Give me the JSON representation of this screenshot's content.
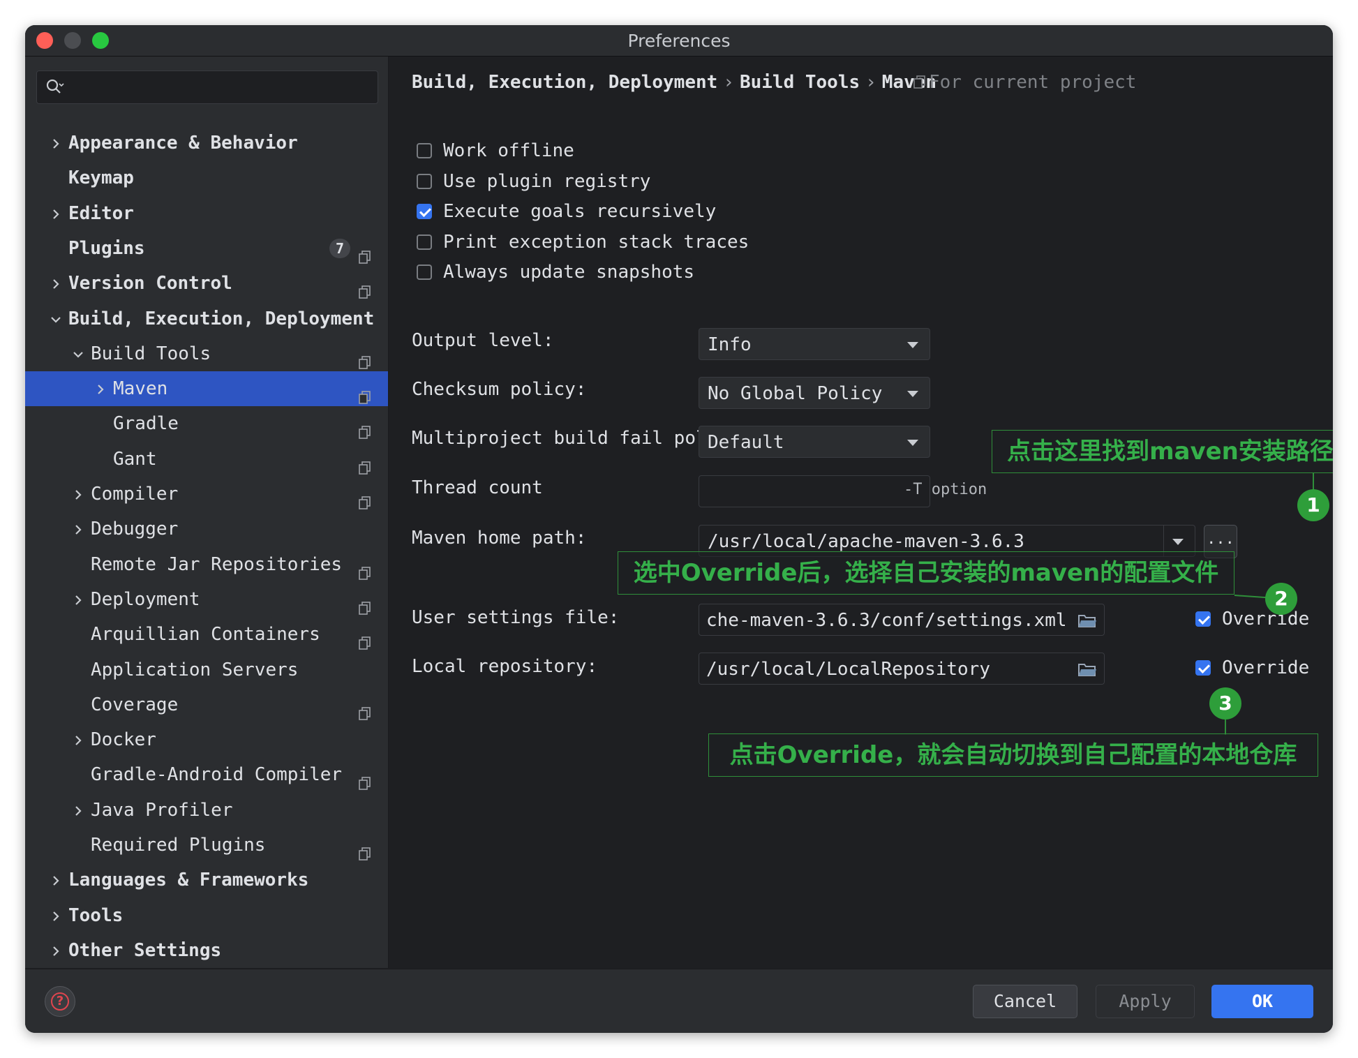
{
  "window": {
    "title": "Preferences"
  },
  "sidebar": {
    "search": {
      "placeholder": ""
    },
    "items": [
      {
        "label": "Appearance & Behavior",
        "expandable": true,
        "expanded": false,
        "bold": true,
        "level": 0,
        "project": false
      },
      {
        "label": "Keymap",
        "expandable": false,
        "bold": true,
        "level": 0,
        "project": false
      },
      {
        "label": "Editor",
        "expandable": true,
        "expanded": false,
        "bold": true,
        "level": 0,
        "project": false
      },
      {
        "label": "Plugins",
        "expandable": false,
        "bold": true,
        "level": 0,
        "project": true,
        "badge": "7"
      },
      {
        "label": "Version Control",
        "expandable": true,
        "expanded": false,
        "bold": true,
        "level": 0,
        "project": true
      },
      {
        "label": "Build, Execution, Deployment",
        "expandable": true,
        "expanded": true,
        "bold": true,
        "level": 0,
        "project": false
      },
      {
        "label": "Build Tools",
        "expandable": true,
        "expanded": true,
        "bold": false,
        "level": 1,
        "project": true
      },
      {
        "label": "Maven",
        "expandable": true,
        "expanded": false,
        "bold": false,
        "level": 2,
        "project": true,
        "selected": true
      },
      {
        "label": "Gradle",
        "expandable": false,
        "bold": false,
        "level": 2,
        "project": true
      },
      {
        "label": "Gant",
        "expandable": false,
        "bold": false,
        "level": 2,
        "project": true
      },
      {
        "label": "Compiler",
        "expandable": true,
        "expanded": false,
        "bold": false,
        "level": 1,
        "project": true
      },
      {
        "label": "Debugger",
        "expandable": true,
        "expanded": false,
        "bold": false,
        "level": 1,
        "project": false
      },
      {
        "label": "Remote Jar Repositories",
        "expandable": false,
        "bold": false,
        "level": 1,
        "project": true
      },
      {
        "label": "Deployment",
        "expandable": true,
        "expanded": false,
        "bold": false,
        "level": 1,
        "project": true
      },
      {
        "label": "Arquillian Containers",
        "expandable": false,
        "bold": false,
        "level": 1,
        "project": true
      },
      {
        "label": "Application Servers",
        "expandable": false,
        "bold": false,
        "level": 1,
        "project": false
      },
      {
        "label": "Coverage",
        "expandable": false,
        "bold": false,
        "level": 1,
        "project": true
      },
      {
        "label": "Docker",
        "expandable": true,
        "expanded": false,
        "bold": false,
        "level": 1,
        "project": false
      },
      {
        "label": "Gradle-Android Compiler",
        "expandable": false,
        "bold": false,
        "level": 1,
        "project": true
      },
      {
        "label": "Java Profiler",
        "expandable": true,
        "expanded": false,
        "bold": false,
        "level": 1,
        "project": false
      },
      {
        "label": "Required Plugins",
        "expandable": false,
        "bold": false,
        "level": 1,
        "project": true
      },
      {
        "label": "Languages & Frameworks",
        "expandable": true,
        "expanded": false,
        "bold": true,
        "level": 0,
        "project": false
      },
      {
        "label": "Tools",
        "expandable": true,
        "expanded": false,
        "bold": true,
        "level": 0,
        "project": false
      },
      {
        "label": "Other Settings",
        "expandable": true,
        "expanded": false,
        "bold": true,
        "level": 0,
        "project": false
      }
    ]
  },
  "breadcrumb": {
    "parts": [
      "Build, Execution, Deployment",
      "Build Tools",
      "Maven"
    ],
    "separator": "›",
    "scope": "For current project"
  },
  "settings": {
    "checkboxes": [
      {
        "label": "Work offline",
        "checked": false
      },
      {
        "label": "Use plugin registry",
        "checked": false
      },
      {
        "label": "Execute goals recursively",
        "checked": true
      },
      {
        "label": "Print exception stack traces",
        "checked": false
      },
      {
        "label": "Always update snapshots",
        "checked": false
      }
    ],
    "output_level": {
      "label": "Output level:",
      "value": "Info"
    },
    "checksum_policy": {
      "label": "Checksum policy:",
      "value": "No Global Policy"
    },
    "multiproject_policy": {
      "label": "Multiproject build fail policy:",
      "value": "Default"
    },
    "thread_count": {
      "label": "Thread count",
      "value": "",
      "hint": "-T option"
    },
    "maven_home": {
      "label": "Maven home path:",
      "value": "/usr/local/apache-maven-3.6.3",
      "browse": "..."
    },
    "user_settings": {
      "label": "User settings file:",
      "value": "che-maven-3.6.3/conf/settings.xml",
      "override_label": "Override",
      "override": true
    },
    "local_repo": {
      "label": "Local repository:",
      "value": "/usr/local/LocalRepository",
      "override_label": "Override",
      "override": true
    }
  },
  "annotations": [
    {
      "number": "1",
      "text": "点击这里找到maven安装路径"
    },
    {
      "number": "2",
      "text": "选中Override后，选择自己安装的maven的配置文件"
    },
    {
      "number": "3",
      "text": "点击Override，就会自动切换到自己配置的本地仓库"
    }
  ],
  "buttons": {
    "cancel": "Cancel",
    "apply": "Apply",
    "ok": "OK"
  },
  "colors": {
    "accent": "#3574f0",
    "selection": "#2e55c2",
    "annotation": "#35b04a"
  }
}
